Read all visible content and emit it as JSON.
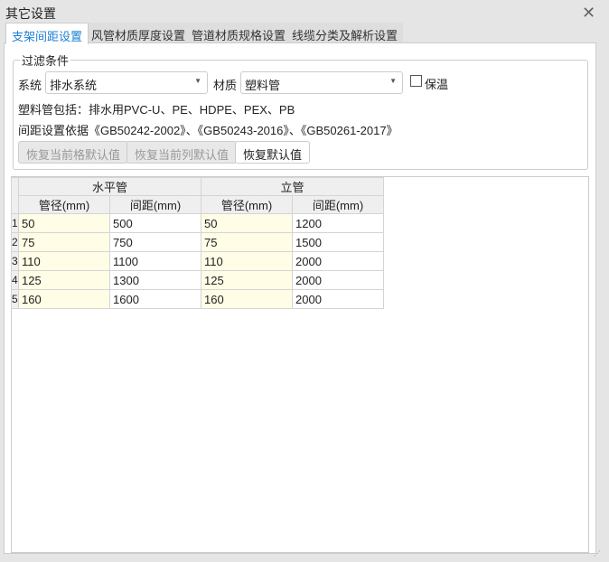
{
  "window": {
    "title": "其它设置"
  },
  "tabs": [
    "支架间距设置",
    "风管材质厚度设置",
    "管道材质规格设置",
    "线缆分类及解析设置"
  ],
  "filter": {
    "group_label": "过滤条件",
    "system_label": "系统",
    "system_value": "排水系统",
    "material_label": "材质",
    "material_value": "塑料管",
    "insulation_label": "保温",
    "insulation_checked": false,
    "info1": "塑料管包括：排水用PVC-U、PE、HDPE、PEX、PB",
    "info2": "间距设置依据《GB50242-2002》、《GB50243-2016》、《GB50261-2017》",
    "buttons": [
      "恢复当前格默认值",
      "恢复当前列默认值",
      "恢复默认值"
    ]
  },
  "table": {
    "groups": [
      "水平管",
      "立管"
    ],
    "columns": [
      "管径(mm)",
      "间距(mm)",
      "管径(mm)",
      "间距(mm)"
    ],
    "rows": [
      [
        "1",
        "50",
        "500",
        "50",
        "1200"
      ],
      [
        "2",
        "75",
        "750",
        "75",
        "1500"
      ],
      [
        "3",
        "110",
        "1100",
        "110",
        "2000"
      ],
      [
        "4",
        "125",
        "1300",
        "125",
        "2000"
      ],
      [
        "5",
        "160",
        "1600",
        "160",
        "2000"
      ]
    ]
  }
}
